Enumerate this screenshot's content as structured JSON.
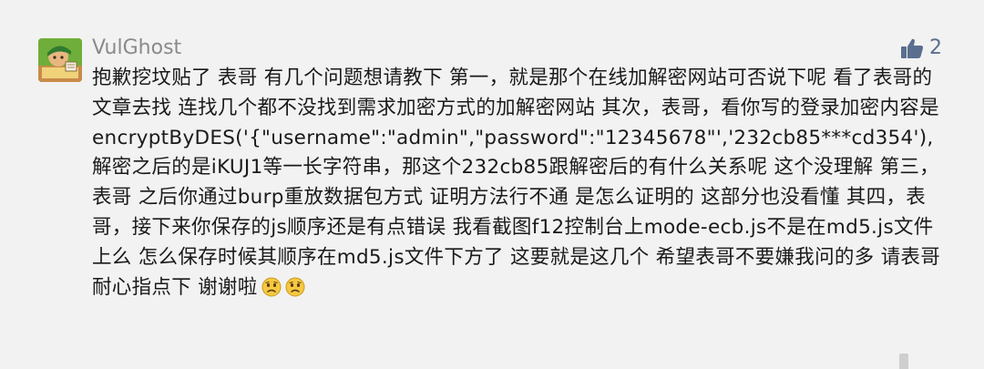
{
  "comment": {
    "username": "VulGhost",
    "like_count": "2",
    "text": "抱歉挖坟贴了 表哥 有几个问题想请教下 第一，就是那个在线加解密网站可否说下呢 看了表哥的文章去找 连找几个都不没找到需求加密方式的加解密网站 其次，表哥，看你写的登录加密内容是encryptByDES('{\"username\":\"admin\",\"password\":\"12345678\"','232cb85***cd354'),解密之后的是iKUJ1等一长字符串，那这个232cb85跟解密后的有什么关系呢 这个没理解 第三，表哥 之后你通过burp重放数据包方式 证明方法行不通 是怎么证明的 这部分也没看懂 其四，表哥，接下来你保存的js顺序还是有点错误 我看截图f12控制台上mode-ecb.js不是在md5.js文件上么 怎么保存时候其顺序在md5.js文件下方了 这要就是这几个 希望表哥不要嫌我问的多 请表哥耐心指点下 谢谢啦"
  },
  "icons": {
    "avatar": "user-avatar",
    "like": "thumbs-up-icon",
    "emoji": "sad-face-emoji"
  },
  "colors": {
    "background": "#f2f2f2",
    "username": "#8a8a8a",
    "like": "#5a6e8f",
    "text": "#1a1a1a"
  }
}
